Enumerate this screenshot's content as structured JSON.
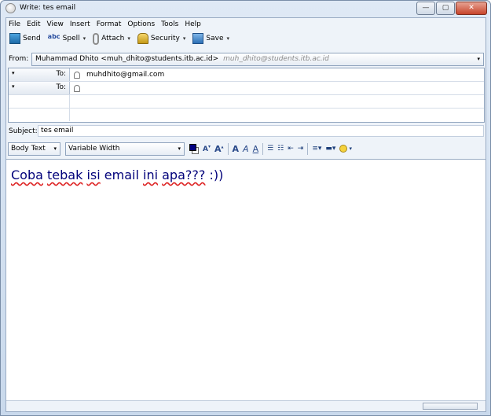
{
  "window": {
    "title": "Write: tes email",
    "controls": {
      "minimize": "—",
      "maximize": "▢",
      "close": "✕"
    }
  },
  "menu": [
    "File",
    "Edit",
    "View",
    "Insert",
    "Format",
    "Options",
    "Tools",
    "Help"
  ],
  "toolbar": {
    "send": "Send",
    "spell": "Spell",
    "spell_icon_text": "abc",
    "attach": "Attach",
    "security": "Security",
    "save": "Save",
    "dropdown_glyph": "▾"
  },
  "header": {
    "from_label": "From:",
    "from_value": "Muhammad Dhito <muh_dhito@students.itb.ac.id>",
    "from_hint": "muh_dhito@students.itb.ac.id",
    "recipients": [
      {
        "type": "To:",
        "address": "muhdhito@gmail.com"
      },
      {
        "type": "To:",
        "address": ""
      }
    ],
    "subject_label": "Subject:",
    "subject_value": "tes email"
  },
  "format": {
    "paragraph_style": "Body Text",
    "font": "Variable Width",
    "text_color": "#000080",
    "background_color": "#ffffff"
  },
  "body": {
    "text_words": [
      "Coba",
      "tebak",
      "isi",
      "email",
      "ini",
      "apa???",
      ":))"
    ]
  }
}
